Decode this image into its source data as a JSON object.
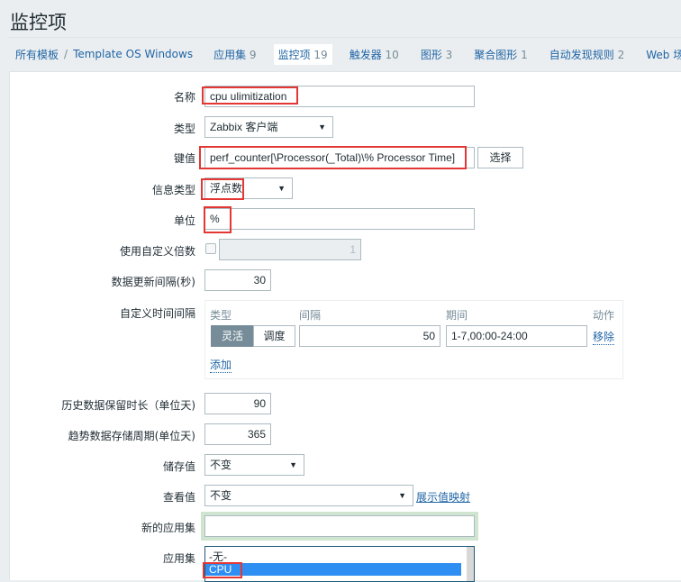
{
  "page": {
    "title": "监控项"
  },
  "nav": {
    "breadcrumb_root": "所有模板",
    "breadcrumb_sep": "/",
    "breadcrumb_template": "Template OS Windows",
    "tabs": [
      {
        "label": "应用集",
        "count": "9",
        "active": false
      },
      {
        "label": "监控项",
        "count": "19",
        "active": true
      },
      {
        "label": "触发器",
        "count": "10",
        "active": false
      },
      {
        "label": "图形",
        "count": "3",
        "active": false
      },
      {
        "label": "聚合图形",
        "count": "1",
        "active": false
      },
      {
        "label": "自动发现规则",
        "count": "2",
        "active": false
      },
      {
        "label": "Web 场景",
        "count": "",
        "active": false
      }
    ]
  },
  "form": {
    "name": {
      "label": "名称",
      "value": "cpu ulimitization"
    },
    "type": {
      "label": "类型",
      "value": "Zabbix 客户端"
    },
    "key": {
      "label": "键值",
      "value": "perf_counter[\\Processor(_Total)\\% Processor Time]",
      "select_button": "选择"
    },
    "info_type": {
      "label": "信息类型",
      "value": "浮点数"
    },
    "units": {
      "label": "单位",
      "value": "%"
    },
    "multiplier": {
      "label": "使用自定义倍数",
      "checked": false,
      "value": "1"
    },
    "update_interval": {
      "label": "数据更新间隔(秒)",
      "value": "30"
    },
    "custom_intervals": {
      "label": "自定义时间间隔",
      "headers": {
        "type": "类型",
        "interval": "间隔",
        "period": "期间",
        "action": "动作"
      },
      "rows": [
        {
          "type_flexible": "灵活",
          "type_scheduling": "调度",
          "selected": "灵活",
          "interval": "50",
          "period": "1-7,00:00-24:00",
          "remove": "移除"
        }
      ],
      "add": "添加"
    },
    "history": {
      "label": "历史数据保留时长（单位天)",
      "value": "90"
    },
    "trends": {
      "label": "趋势数据存储周期(单位天)",
      "value": "365"
    },
    "store_value": {
      "label": "储存值",
      "value": "不变"
    },
    "show_value": {
      "label": "查看值",
      "value": "不变",
      "link": "展示值映射"
    },
    "new_application": {
      "label": "新的应用集",
      "value": ""
    },
    "applications": {
      "label": "应用集",
      "options": [
        "-无-",
        "CPU"
      ],
      "selected": "CPU"
    }
  },
  "icons": {
    "dropdown": "▼"
  }
}
